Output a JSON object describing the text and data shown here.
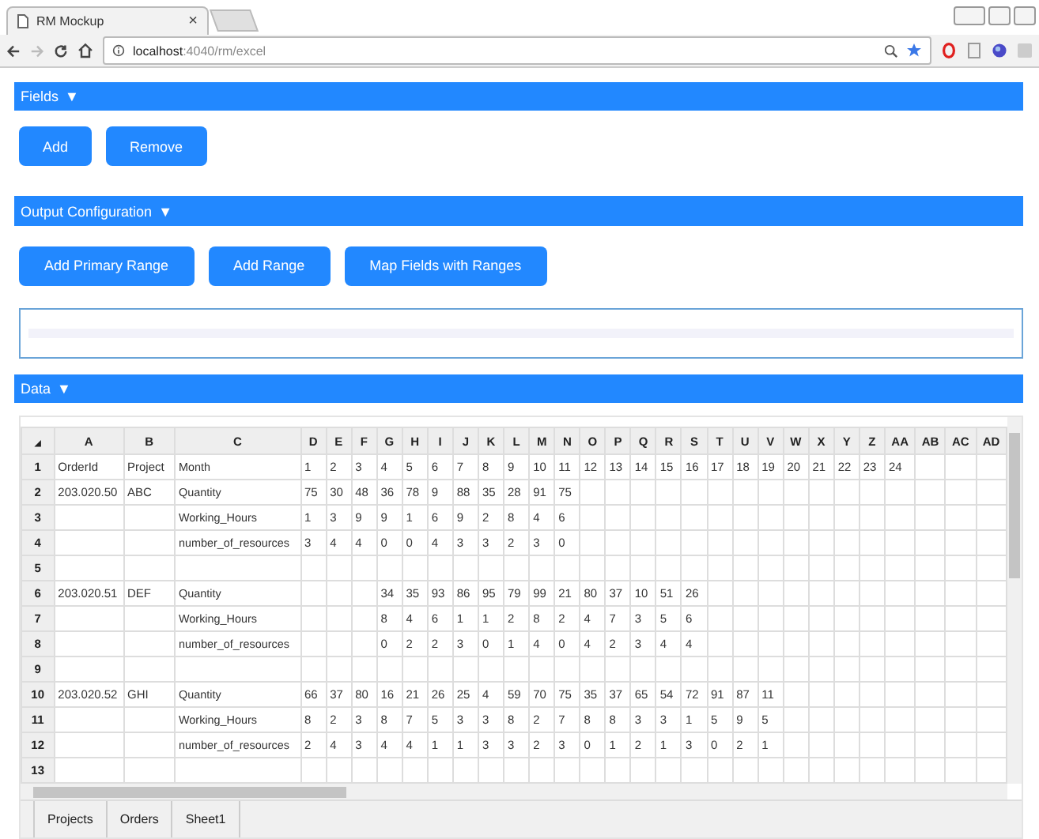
{
  "browser": {
    "tab_title": "RM Mockup",
    "tab_close": "×",
    "url_host": "localhost",
    "url_path": ":4040/rm/excel"
  },
  "sections": [
    {
      "title": "Fields",
      "toggle": "▼",
      "kind": "buttons",
      "buttons": [
        "Add",
        "Remove"
      ]
    },
    {
      "title": "Output Configuration",
      "toggle": "▼",
      "kind": "buttons-output",
      "buttons": [
        "Add Primary Range",
        "Add Range",
        "Map Fields with Ranges"
      ]
    },
    {
      "title": "Data",
      "toggle": "▼",
      "kind": "sheet"
    }
  ],
  "sheet": {
    "corner": "◢",
    "columns": [
      "A",
      "B",
      "C",
      "D",
      "E",
      "F",
      "G",
      "H",
      "I",
      "J",
      "K",
      "L",
      "M",
      "N",
      "O",
      "P",
      "Q",
      "R",
      "S",
      "T",
      "U",
      "V",
      "W",
      "X",
      "Y",
      "Z",
      "AA",
      "AB",
      "AC",
      "AD"
    ],
    "rows": [
      {
        "number": "1",
        "cells": [
          "OrderId",
          "Project",
          "Month",
          "1",
          "2",
          "3",
          "4",
          "5",
          "6",
          "7",
          "8",
          "9",
          "10",
          "11",
          "12",
          "13",
          "14",
          "15",
          "16",
          "17",
          "18",
          "19",
          "20",
          "21",
          "22",
          "23",
          "24"
        ]
      },
      {
        "number": "2",
        "cells": [
          "203.020.50",
          "ABC",
          "Quantity",
          "75",
          "30",
          "48",
          "36",
          "78",
          "9",
          "88",
          "35",
          "28",
          "91",
          "75"
        ]
      },
      {
        "number": "3",
        "cells": [
          null,
          null,
          "Working_Hours",
          "1",
          "3",
          "9",
          "9",
          "1",
          "6",
          "9",
          "2",
          "8",
          "4",
          "6"
        ]
      },
      {
        "number": "4",
        "cells": [
          null,
          null,
          "number_of_resources",
          "3",
          "4",
          "4",
          "0",
          "0",
          "4",
          "3",
          "3",
          "2",
          "3",
          "0"
        ]
      },
      {
        "number": "5"
      },
      {
        "number": "6",
        "cells": [
          "203.020.51",
          "DEF",
          "Quantity",
          null,
          null,
          null,
          "34",
          "35",
          "93",
          "86",
          "95",
          "79",
          "99",
          "21",
          "80",
          "37",
          "10",
          "51",
          "26"
        ]
      },
      {
        "number": "7",
        "cells": [
          null,
          null,
          "Working_Hours",
          null,
          null,
          null,
          "8",
          "4",
          "6",
          "1",
          "1",
          "2",
          "8",
          "2",
          "4",
          "7",
          "3",
          "5",
          "6"
        ]
      },
      {
        "number": "8",
        "cells": [
          null,
          null,
          "number_of_resources",
          null,
          null,
          null,
          "0",
          "2",
          "2",
          "3",
          "0",
          "1",
          "4",
          "0",
          "4",
          "2",
          "3",
          "4",
          "4"
        ]
      },
      {
        "number": "9"
      },
      {
        "number": "10",
        "cells": [
          "203.020.52",
          "GHI",
          "Quantity",
          "66",
          "37",
          "80",
          "16",
          "21",
          "26",
          "25",
          "4",
          "59",
          "70",
          "75",
          "35",
          "37",
          "65",
          "54",
          "72",
          "91",
          "87",
          "11"
        ]
      },
      {
        "number": "11",
        "cells": [
          null,
          null,
          "Working_Hours",
          "8",
          "2",
          "3",
          "8",
          "7",
          "5",
          "3",
          "3",
          "8",
          "2",
          "7",
          "8",
          "8",
          "3",
          "3",
          "1",
          "5",
          "9",
          "5"
        ]
      },
      {
        "number": "12",
        "cells": [
          null,
          null,
          "number_of_resources",
          "2",
          "4",
          "3",
          "4",
          "4",
          "1",
          "1",
          "3",
          "3",
          "2",
          "3",
          "0",
          "1",
          "2",
          "1",
          "3",
          "0",
          "2",
          "1"
        ]
      },
      {
        "number": "13"
      }
    ],
    "tabs": [
      {
        "label": "Projects",
        "selected": false
      },
      {
        "label": "Orders",
        "selected": false
      },
      {
        "label": "Sheet1",
        "selected": false
      }
    ]
  }
}
